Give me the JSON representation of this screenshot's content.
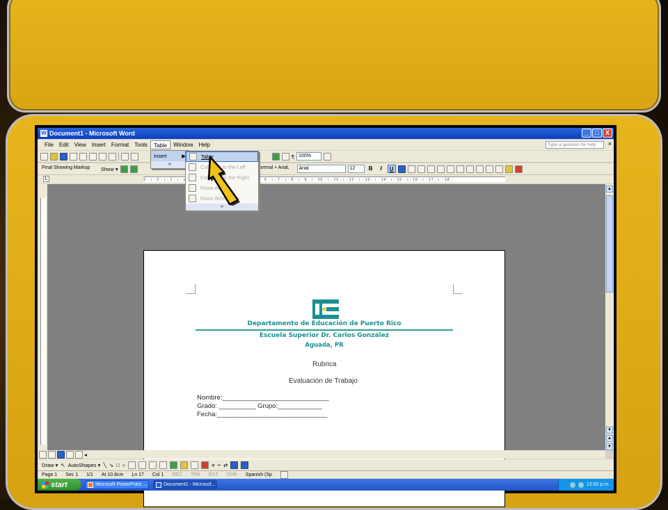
{
  "window": {
    "title": "Document1 - Microsoft Word",
    "min": "_",
    "max": "□",
    "close": "X"
  },
  "menubar": {
    "items": [
      "File",
      "Edit",
      "View",
      "Insert",
      "Format",
      "Tools",
      "Table",
      "Window",
      "Help"
    ],
    "help_placeholder": "Type a question for help",
    "close": "×"
  },
  "toolbar": {
    "zoom": "100%",
    "markup": "Final Showing Markup",
    "show": "Show ▾",
    "style": "Normal + Arial,",
    "font": "Arial",
    "size": "12",
    "bold": "B",
    "italic": "I",
    "underline": "U"
  },
  "ruler": {
    "marks": "3 · ı · 2 · ı · 1 · ı · ⊾ · ı · 1 · ı · 2 · ı · 3 · ı · 4 · ı · 5 · ı · 6 · ı · 7 · ı · 8 · ı · 9 · ı · 10 · ı · 11 · ı · 12 · ı · 13 · ı · 14 · ı · 15 · ı · 16 · ı · 17 · ı · 18 ·",
    "tab_stop": "L"
  },
  "menus": {
    "table_dropdown": [
      {
        "label": "Insert",
        "arrow": "▶"
      }
    ],
    "table_expand": "»",
    "insert_submenu": [
      {
        "label": "Table",
        "state": "highlighted"
      },
      {
        "label": "Columns to the Left",
        "state": "disabled"
      },
      {
        "label": "Columns to the Right",
        "state": "disabled"
      },
      {
        "label": "Rows Above",
        "state": "disabled"
      },
      {
        "label": "Rows Below",
        "state": "disabled"
      }
    ],
    "insert_expand": "»"
  },
  "document": {
    "logo_text": "DE",
    "org_name": "Departamento de Educación de Puerto Rico",
    "school": "Escuela Superior Dr. Carlos González",
    "location": "Aguada, PR",
    "heading": "Rubrica",
    "subheading": "Evaluación de Trabajo",
    "form_lines": [
      "Nombre:_____________________________",
      "Grado: __________ Grupo:____________",
      "Fecha:______________________________"
    ]
  },
  "drawbar": {
    "draw": "Draw ▾",
    "autoshapes": "AutoShapes ▾"
  },
  "statusbar": {
    "page": "Page 1",
    "sec": "Sec 1",
    "pages": "1/1",
    "at": "At 10.8cm",
    "ln": "Ln 17",
    "col": "Col 1",
    "rec": "REC",
    "trk": "TRK",
    "ext": "EXT",
    "ovr": "OVR",
    "language": "Spanish (Sp"
  },
  "taskbar": {
    "start": "start",
    "tasks": [
      "Microsoft PowerPoint ...",
      "Document1 - Microsof..."
    ],
    "clock": "12:50 p.m."
  },
  "colors": {
    "accent_teal": "#1b8f93",
    "titlebar_blue": "#0b3fbf",
    "slide_gold": "#e0ab18"
  }
}
